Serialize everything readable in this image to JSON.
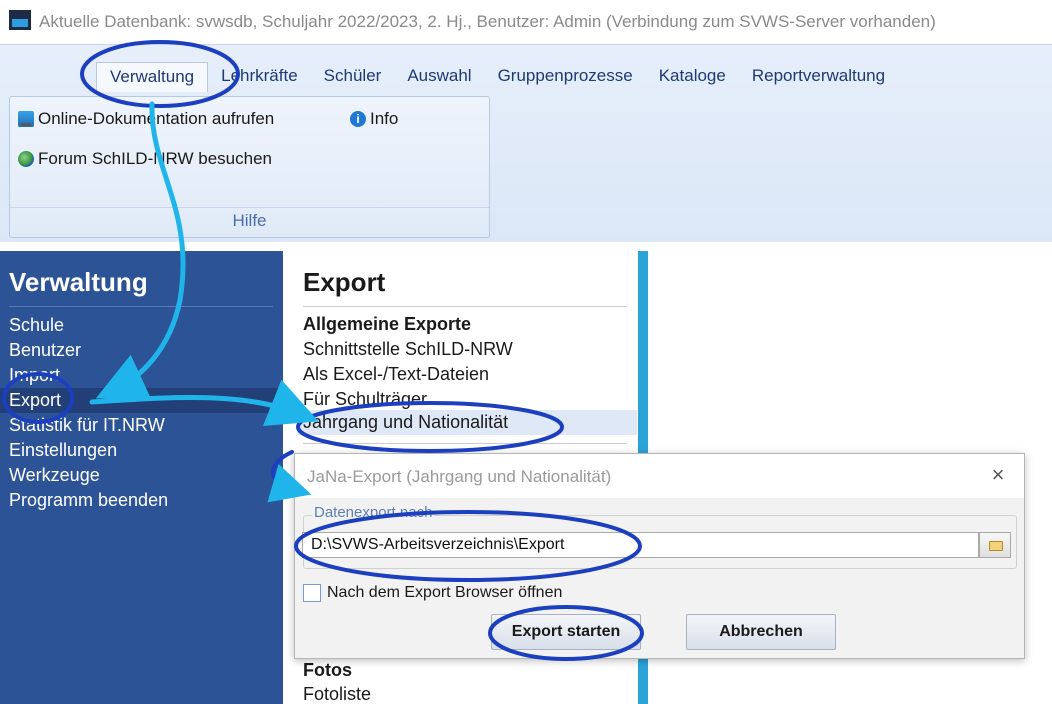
{
  "window": {
    "title": "Aktuelle Datenbank: svwsdb, Schuljahr 2022/2023, 2. Hj., Benutzer: Admin (Verbindung zum SVWS-Server vorhanden)"
  },
  "ribbon": {
    "tabs": [
      {
        "label": "Verwaltung"
      },
      {
        "label": "Lehrkräfte"
      },
      {
        "label": "Schüler"
      },
      {
        "label": "Auswahl"
      },
      {
        "label": "Gruppenprozesse"
      },
      {
        "label": "Kataloge"
      },
      {
        "label": "Reportverwaltung"
      }
    ],
    "active_tab": "Verwaltung",
    "group": {
      "label": "Hilfe",
      "buttons": [
        {
          "label": "Online-Dokumentation aufrufen",
          "icon": "document-icon"
        },
        {
          "label": "Info",
          "icon": "info-icon"
        },
        {
          "label": "Forum SchILD-NRW besuchen",
          "icon": "globe-icon"
        }
      ]
    }
  },
  "sidebar": {
    "title": "Verwaltung",
    "items": [
      {
        "label": "Schule"
      },
      {
        "label": "Benutzer"
      },
      {
        "label": "Import"
      },
      {
        "label": "Export"
      },
      {
        "label": "Statistik für IT.NRW"
      },
      {
        "label": "Einstellungen"
      },
      {
        "label": "Werkzeuge"
      },
      {
        "label": "Programm beenden"
      }
    ],
    "selected": "Export"
  },
  "export_panel": {
    "title": "Export",
    "section_general": "Allgemeine Exporte",
    "items": [
      {
        "label": "Schnittstelle SchILD-NRW"
      },
      {
        "label": "Als Excel-/Text-Dateien"
      },
      {
        "label": "Für Schulträger"
      },
      {
        "label": "Jahrgang und Nationalität"
      }
    ],
    "selected": "Jahrgang und Nationalität",
    "section_photos": "Fotos",
    "photo_items": [
      {
        "label": "Fotoliste"
      }
    ]
  },
  "dialog": {
    "title": "JaNa-Export (Jahrgang und Nationalität)",
    "fieldset_label": "Datenexport nach",
    "path_value": "D:\\SVWS-Arbeitsverzeichnis\\Export",
    "checkbox_label": "Nach dem Export Browser öffnen",
    "checkbox_checked": false,
    "export_button": "Export starten",
    "cancel_button": "Abbrechen",
    "close_glyph": "×"
  },
  "colors": {
    "sidebar_bg": "#2d5397",
    "ribbon_bg": "#dbe7f7",
    "accent_strip": "#2ba3d9",
    "annotation_ellipse": "#1b3fbf",
    "annotation_arrow": "#20b5ea"
  }
}
